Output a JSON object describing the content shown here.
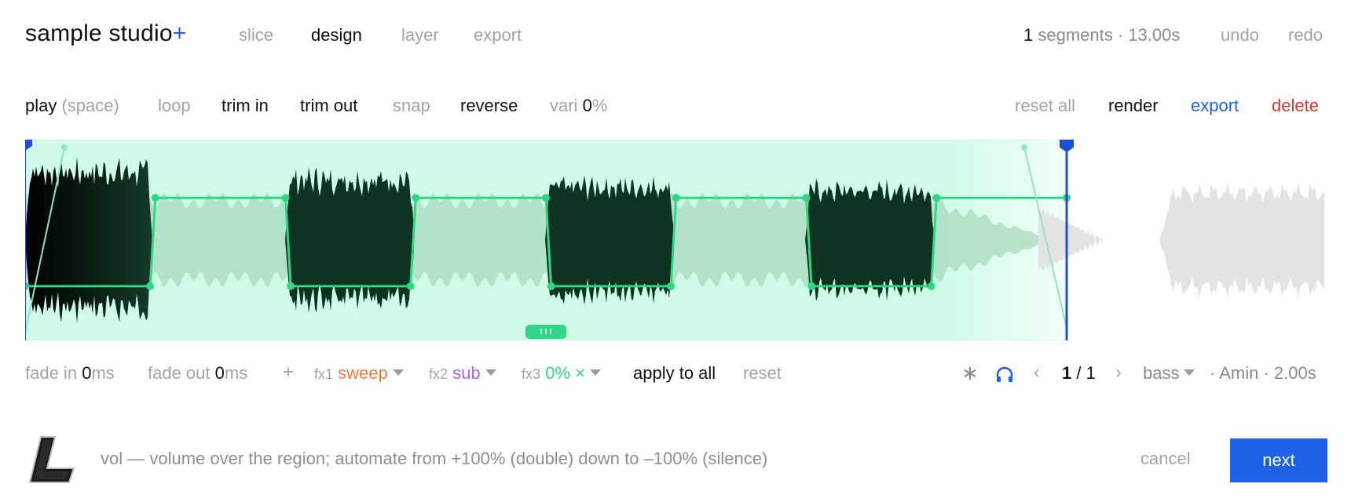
{
  "header": {
    "brand": "sample studio",
    "brand_plus": "+",
    "tabs": [
      "slice",
      "design",
      "layer",
      "export"
    ],
    "active_tab": "design",
    "segments_count": "1",
    "segments_info": "segments · 13.00s",
    "undo": "undo",
    "redo": "redo"
  },
  "toolbar": {
    "play": "play",
    "play_hint": "(space)",
    "loop": "loop",
    "trim_in": "trim in",
    "trim_out": "trim out",
    "snap": "snap",
    "reverse": "reverse",
    "vari_label": "vari",
    "vari_value": "0",
    "vari_unit": "%",
    "reset_all": "reset all",
    "render": "render",
    "export": "export",
    "delete": "delete"
  },
  "waveform": {
    "region_color": "#cffbe6",
    "envelope_color": "#2fd785",
    "wave_dark": "#0f3322",
    "wave_ghost": "#e3e3e3",
    "marker_color": "#1f4fd6",
    "handle_icon": "grip-handle-icon",
    "volume_envelope": [
      {
        "t": 0.0,
        "level": 0.27
      },
      {
        "t": 0.12,
        "level": 0.27
      },
      {
        "t": 0.125,
        "level": 0.71
      },
      {
        "t": 0.25,
        "level": 0.71
      },
      {
        "t": 0.255,
        "level": 0.27
      },
      {
        "t": 0.37,
        "level": 0.27
      },
      {
        "t": 0.375,
        "level": 0.71
      },
      {
        "t": 0.5,
        "level": 0.71
      },
      {
        "t": 0.505,
        "level": 0.27
      },
      {
        "t": 0.62,
        "level": 0.27
      },
      {
        "t": 0.625,
        "level": 0.71
      },
      {
        "t": 0.75,
        "level": 0.71
      },
      {
        "t": 0.755,
        "level": 0.27
      },
      {
        "t": 0.87,
        "level": 0.27
      },
      {
        "t": 0.875,
        "level": 0.71
      },
      {
        "t": 1.0,
        "level": 0.71
      }
    ]
  },
  "controls": {
    "fade_in_label": "fade in",
    "fade_in_value": "0",
    "fade_in_unit": "ms",
    "fade_out_label": "fade out",
    "fade_out_value": "0",
    "fade_out_unit": "ms",
    "add": "+",
    "fx1_label": "fx1",
    "fx1_value": "sweep",
    "fx1_color": "#f07b3f",
    "fx2_label": "fx2",
    "fx2_value": "sub",
    "fx2_color": "#a55ee8",
    "fx3_label": "fx3",
    "fx3_value": "0%",
    "fx3_clear": "×",
    "fx3_color": "#2fd785",
    "apply_to_all": "apply to all",
    "reset": "reset",
    "asterisk": "∗",
    "headphones_icon": "headphones-icon",
    "prev": "‹",
    "page_current": "1",
    "page_sep": "/ 1",
    "next": "›",
    "instrument": "bass",
    "key_info": "· Amin · 2.00s"
  },
  "footer": {
    "logo_letter": "L",
    "hint": "vol — volume over the region; automate from +100% (double) down to –100% (silence)",
    "cancel": "cancel",
    "next": "next"
  }
}
